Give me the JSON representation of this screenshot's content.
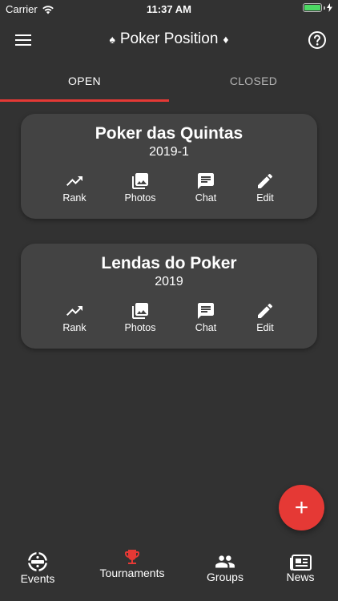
{
  "status_bar": {
    "carrier": "Carrier",
    "time": "11:37 AM"
  },
  "app_bar": {
    "title": "Poker Position",
    "left_suit": "♠",
    "right_suit": "♦"
  },
  "tabs": [
    {
      "label": "OPEN",
      "selected": true
    },
    {
      "label": "CLOSED",
      "selected": false
    }
  ],
  "groups": [
    {
      "name": "Poker das Quintas",
      "season": "2019-1",
      "actions": {
        "rank": "Rank",
        "photos": "Photos",
        "chat": "Chat",
        "edit": "Edit"
      }
    },
    {
      "name": "Lendas do Poker",
      "season": "2019",
      "actions": {
        "rank": "Rank",
        "photos": "Photos",
        "chat": "Chat",
        "edit": "Edit"
      }
    }
  ],
  "fab": {
    "icon": "+"
  },
  "bottom_nav": {
    "events": "Events",
    "tournaments": "Tournaments",
    "groups": "Groups",
    "news": "News"
  },
  "colors": {
    "background": "#323232",
    "card": "#434343",
    "accent": "#e53935",
    "inactive_tab": "#b5b5b5"
  }
}
